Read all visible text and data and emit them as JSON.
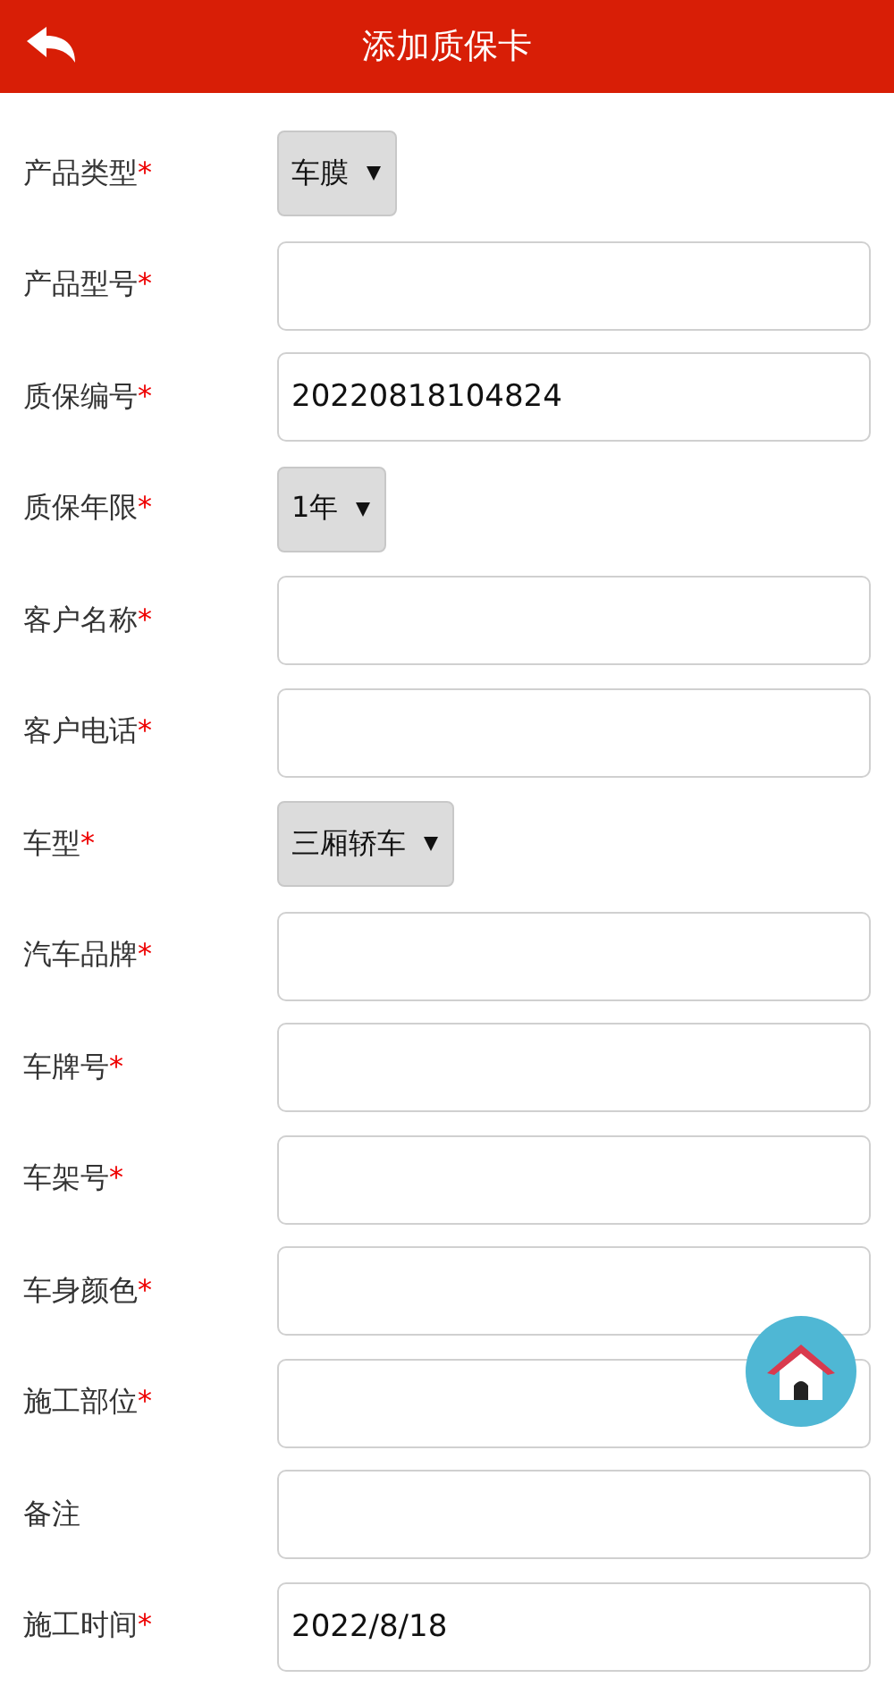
{
  "header": {
    "title": "添加质保卡"
  },
  "fields": [
    {
      "label": "产品类型",
      "mark": "*",
      "kind": "select",
      "value": "车膜"
    },
    {
      "label": "产品型号",
      "mark": "*",
      "kind": "text"
    },
    {
      "label": "质保编号",
      "mark": "*",
      "kind": "text",
      "value": "20220818104824"
    },
    {
      "label": "质保年限",
      "mark": "*",
      "kind": "select",
      "value": "1年"
    },
    {
      "label": "客户名称",
      "mark": "*",
      "kind": "text"
    },
    {
      "label": "客户电话",
      "mark": "*",
      "kind": "text"
    },
    {
      "label": "车型",
      "mark": "*",
      "kind": "select",
      "value": "三厢轿车"
    },
    {
      "label": "汽车品牌",
      "mark": "*",
      "kind": "text"
    },
    {
      "label": "车牌号",
      "mark": "*",
      "kind": "text"
    },
    {
      "label": "车架号",
      "mark": "*",
      "kind": "text"
    },
    {
      "label": "车身颜色",
      "mark": "*",
      "kind": "text"
    },
    {
      "label": "施工部位",
      "mark": "*",
      "kind": "text"
    },
    {
      "label": "备注",
      "kind": "text"
    },
    {
      "label": "施工时间",
      "mark": "*",
      "kind": "text",
      "value": "2022/8/18"
    }
  ]
}
